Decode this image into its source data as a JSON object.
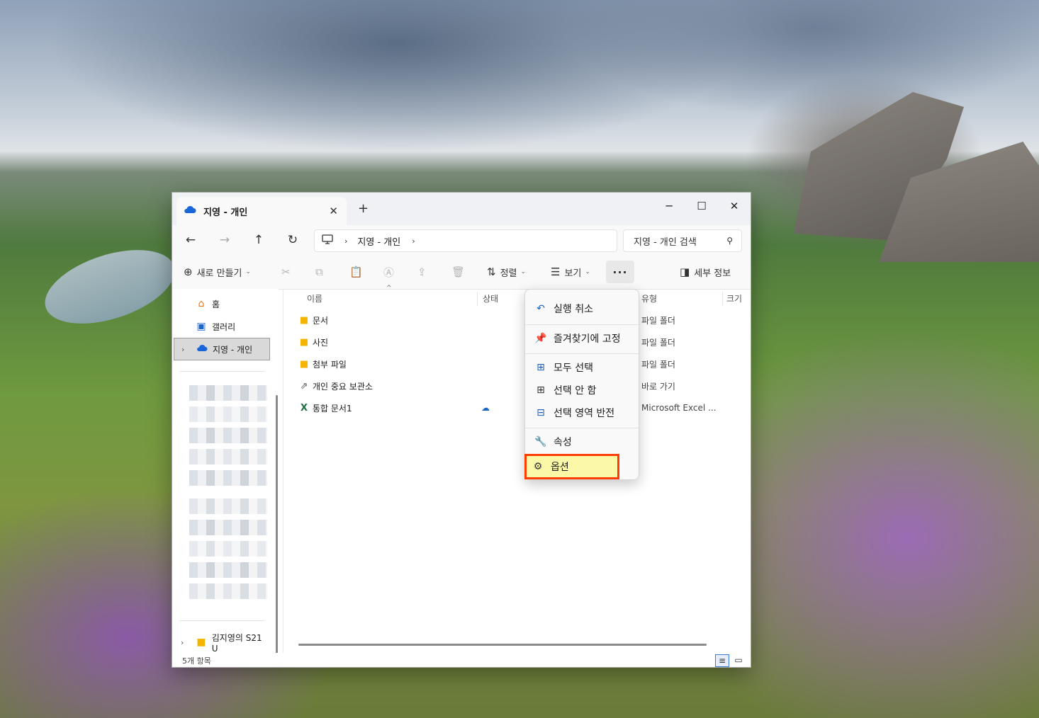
{
  "window": {
    "tab_title": "지영 - 개인",
    "tab_close": "✕",
    "new_tab": "+",
    "minimize": "─",
    "maximize": "☐",
    "close": "✕"
  },
  "nav": {
    "back": "←",
    "forward": "→",
    "up": "↑",
    "refresh": "↻",
    "breadcrumb": "지영 - 개인",
    "search_placeholder": "지영 - 개인 검색"
  },
  "toolbar": {
    "new_label": "새로 만들기",
    "sort_label": "정렬",
    "view_label": "보기",
    "more_label": "···",
    "details_label": "세부 정보"
  },
  "sidebar": {
    "items": [
      {
        "label": "홈",
        "icon": "home-icon"
      },
      {
        "label": "갤러리",
        "icon": "gallery-icon"
      },
      {
        "label": "지영 - 개인",
        "icon": "onedrive-icon"
      },
      {
        "label": "김지영의 S21 U",
        "icon": "folder-icon"
      }
    ]
  },
  "columns": {
    "name": "이름",
    "status": "상태",
    "type": "유형",
    "size": "크기"
  },
  "files": [
    {
      "name": "문서",
      "type": "파일 폴더",
      "icon": "folder-icon",
      "status": ""
    },
    {
      "name": "사진",
      "type": "파일 폴더",
      "icon": "folder-icon",
      "status": ""
    },
    {
      "name": "첨부 파일",
      "type": "파일 폴더",
      "icon": "folder-icon",
      "status": ""
    },
    {
      "name": "개인 중요 보관소",
      "type": "바로 가기",
      "icon": "shortcut-icon",
      "status": ""
    },
    {
      "name": "통합 문서1",
      "type": "Microsoft Excel ...",
      "icon": "excel-icon",
      "status": "☁"
    }
  ],
  "status": {
    "count": "5개 항목"
  },
  "menu": {
    "items": [
      {
        "label": "실행 취소",
        "icon": "undo-icon"
      },
      {
        "label": "즐겨찾기에 고정",
        "icon": "pin-icon"
      },
      {
        "label": "모두 선택",
        "icon": "select-all-icon"
      },
      {
        "label": "선택 안 함",
        "icon": "select-none-icon"
      },
      {
        "label": "선택 영역 반전",
        "icon": "invert-selection-icon"
      },
      {
        "label": "속성",
        "icon": "wrench-icon"
      },
      {
        "label": "옵션",
        "icon": "gear-icon"
      }
    ]
  },
  "colors": {
    "accent": "#1a5fb4",
    "highlight_fill": "#fbf8a8",
    "highlight_border": "#ff3d00",
    "folder": "#f4b400"
  }
}
